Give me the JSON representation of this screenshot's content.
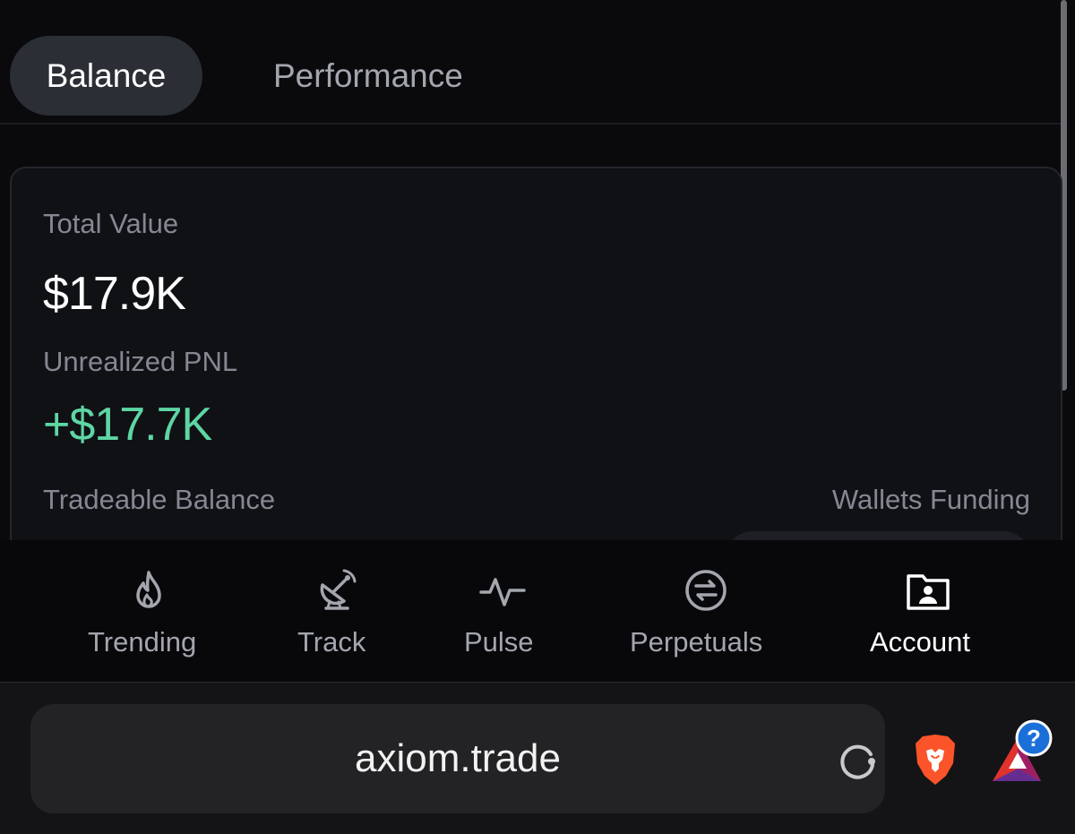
{
  "tabs": {
    "balance": "Balance",
    "performance": "Performance",
    "active": "Balance"
  },
  "card": {
    "total_value_label": "Total Value",
    "total_value": "$17.9K",
    "unrealized_pnl_label": "Unrealized PNL",
    "unrealized_pnl": "+$17.7K",
    "tradeable_balance_label": "Tradeable Balance",
    "wallets_funding_label": "Wallets Funding"
  },
  "nav": {
    "items": [
      {
        "label": "Trending",
        "icon": "flame-icon"
      },
      {
        "label": "Track",
        "icon": "satellite-dish-icon"
      },
      {
        "label": "Pulse",
        "icon": "pulse-icon"
      },
      {
        "label": "Perpetuals",
        "icon": "swap-circle-icon"
      },
      {
        "label": "Account",
        "icon": "account-folder-icon"
      }
    ],
    "active": "Account"
  },
  "browser": {
    "url": "axiom.trade",
    "notification_badge": "?"
  },
  "colors": {
    "background": "#0a0a0d",
    "card": "#101115",
    "active_tab": "#2c2e35",
    "positive": "#5ed6a4",
    "muted_text": "#858892"
  }
}
